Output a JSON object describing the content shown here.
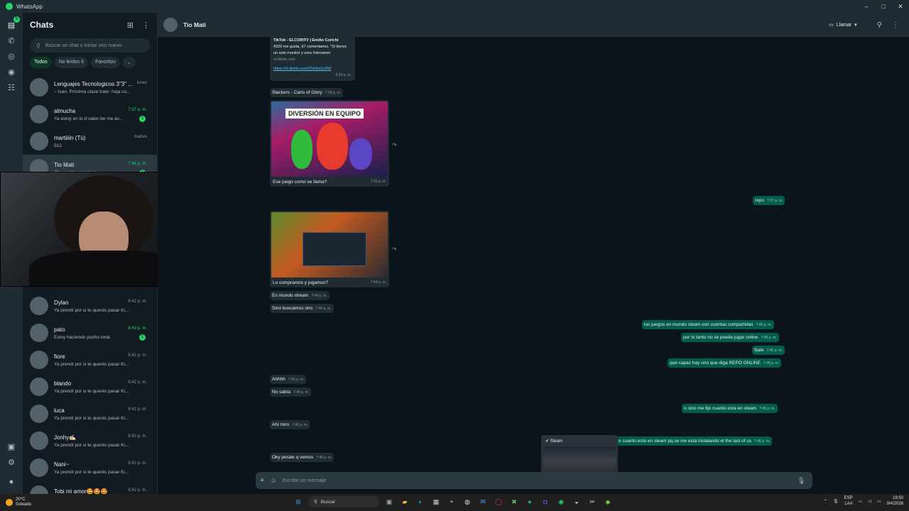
{
  "app": {
    "title": "WhatsApp"
  },
  "window_controls": {
    "minimize": "–",
    "maximize": "□",
    "close": "✕"
  },
  "rail": {
    "chats_badge": "6"
  },
  "sidebar": {
    "title": "Chats",
    "search_placeholder": "Buscar un chat o iniciar uno nuevo",
    "filters": [
      "Todos",
      "No leídos 6",
      "Favoritos",
      "⌄"
    ],
    "chats": [
      {
        "name": "Lenguajes Tecnologicos 3\"3\" ...",
        "time": "lunes",
        "msg": "~ Ivan: Próxima clase traer: hoja cu...",
        "unread": "",
        "green": false,
        "selected": false
      },
      {
        "name": "almucha",
        "time": "7:37 p. m.",
        "msg": "Ya estoy en lo d valen be me av...",
        "unread": "1",
        "green": true,
        "selected": false
      },
      {
        "name": "martiiiin (Tú)",
        "time": "martes",
        "msg": "512",
        "unread": "",
        "green": false,
        "selected": false
      },
      {
        "name": "Tio Mati",
        "time": "7:46 p. m.",
        "msg": "Oky perate q vemos",
        "unread": "1",
        "green": true,
        "selected": true
      },
      {
        "name": "Dylan",
        "time": "6:42 p. m.",
        "msg": "Ya prendí por si te querés pasar  Ki...",
        "unread": "",
        "green": false,
        "selected": false
      },
      {
        "name": "pato",
        "time": "6:43 p. m.",
        "msg": "Estoy haciendo pocho torta",
        "unread": "1",
        "green": true,
        "selected": false
      },
      {
        "name": "fiore",
        "time": "6:42 p. m.",
        "msg": "Ya prendí por si te querés pasar  Ki...",
        "unread": "",
        "green": false,
        "selected": false
      },
      {
        "name": "blando",
        "time": "6:42 p. m.",
        "msg": "Ya prendí por si te querés pasar  Ki...",
        "unread": "",
        "green": false,
        "selected": false
      },
      {
        "name": "luca",
        "time": "6:42 p. m.",
        "msg": "Ya prendí por si te querés pasar  Ki...",
        "unread": "",
        "green": false,
        "selected": false
      },
      {
        "name": "Jonhy✍🏻",
        "time": "6:42 p. m.",
        "msg": "Ya prendí por si te querés pasar  Ki...",
        "unread": "",
        "green": false,
        "selected": false
      },
      {
        "name": "Nani~",
        "time": "6:42 p. m.",
        "msg": "Ya prendí por si te querés pasar  Ki...",
        "unread": "",
        "green": false,
        "selected": false
      },
      {
        "name": "Tobi mi amor🤩🤩🤩",
        "time": "6:42 p. m.",
        "msg": "Ya prendí por si te querés pasar  Ki...",
        "unread": "",
        "green": false,
        "selected": false
      }
    ]
  },
  "conversation": {
    "contact": "Tio Mati",
    "call_label": "Llamar",
    "link_card": {
      "title": "TikTok - ELCORITV | Emilio Corichi",
      "desc": "4329 me gusta, 67 comentarios. \"Si tienes un solo monitor y eres #streamer",
      "domain": "vt.tiktok.com",
      "url": "https://vt.tiktok.com/ZSH9xGx5M/",
      "time": "6:55 p. m."
    },
    "messages": [
      {
        "text": "Slackers - Carts of Glory",
        "time": "7:09 p. m."
      },
      {
        "text": "Ese juego como se llama?",
        "time": "7:33 p. m."
      },
      {
        "text": "repo",
        "time": "7:37 p. m."
      },
      {
        "text": "Lo compramos y jugamos?",
        "time": "7:44 p. m."
      },
      {
        "text": "En mundo stream",
        "time": "7:44 p. m."
      },
      {
        "text": "Sino buscamos otro",
        "time": "7:45 p. m."
      },
      {
        "text": "los juegos en mundo steam son cuentas compartidas",
        "time": "7:45 p. m."
      },
      {
        "text": "por lo tanto no se puede jugar online",
        "time": "7:45 p. m."
      },
      {
        "text": "fijate",
        "time": "7:45 p. m."
      },
      {
        "text": "que capaz hay uno que diga REPO ONLINE",
        "time": "7:45 p. m."
      },
      {
        "text": "Ahhhh",
        "time": "7:45 p. m."
      },
      {
        "text": "No sabía",
        "time": "7:45 p. m."
      },
      {
        "text": "o sino me fijo cuanto esta en steam",
        "time": "7:45 p. m."
      },
      {
        "text": "Ahí miro",
        "time": "7:45 p. m."
      },
      {
        "text": "e cuanto esta en steam pq se me esta instalando el the last of us",
        "time": "7:46 p. m."
      },
      {
        "text": "Oky perate q vemos",
        "time": "7:46 p. m."
      }
    ],
    "image_banner": "DIVERSIÓN EN EQUIPO",
    "composer_placeholder": "Escribe un mensaje"
  },
  "steam_preview": {
    "title": "Steam"
  },
  "taskbar": {
    "temp": "20°C",
    "condition": "Soleado",
    "search": "Buscar",
    "lang1": "ESP",
    "lang2": "LAA",
    "time": "19:50",
    "date": "9/4/2026"
  }
}
